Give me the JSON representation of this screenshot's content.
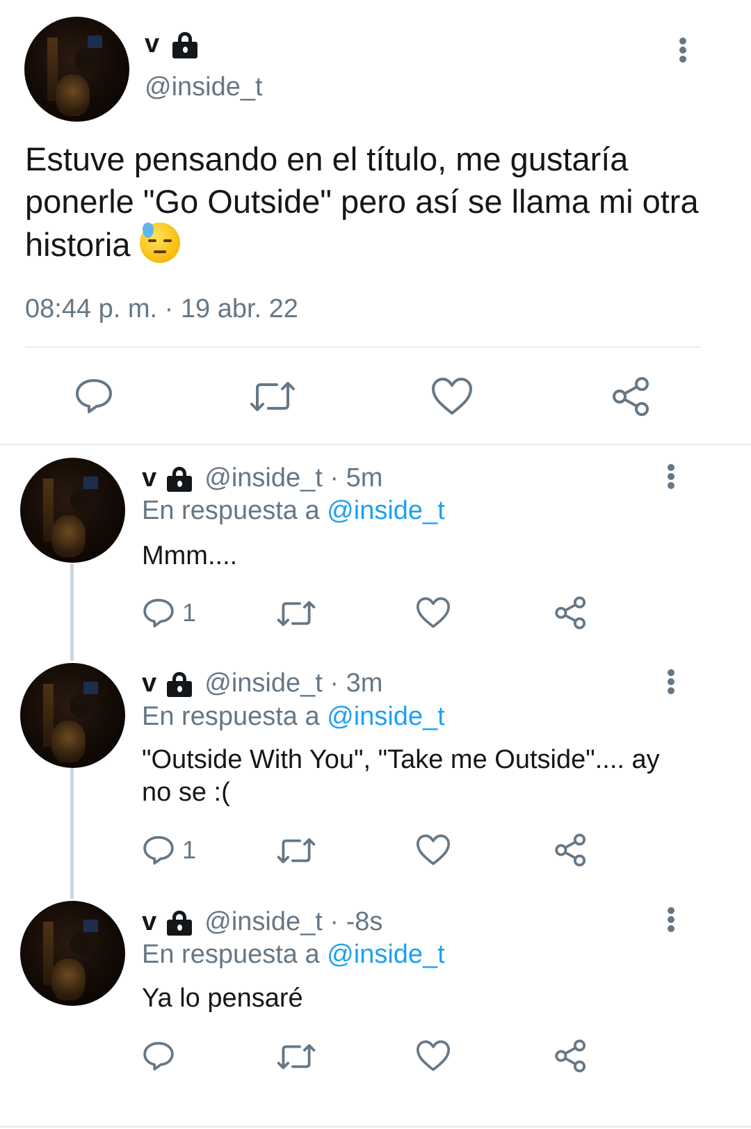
{
  "main_tweet": {
    "name": "v",
    "handle": "@inside_t",
    "text": "Estuve pensando en el título, me gustaría ponerle \"Go Outside\" pero así se llama mi otra historia",
    "emoji": "downcast-face-with-sweat",
    "timestamp": "08:44 p. m. · 19 abr. 22"
  },
  "replies": [
    {
      "name": "v",
      "handle": "@inside_t",
      "time": " · 5m",
      "reply_prefix": "En respuesta a ",
      "reply_to": "@inside_t",
      "text": "Mmm....",
      "reply_count": "1"
    },
    {
      "name": "v",
      "handle": "@inside_t",
      "time": " · 3m",
      "reply_prefix": "En respuesta a ",
      "reply_to": "@inside_t",
      "text": "\"Outside With You\", \"Take me Outside\".... ay no se :(",
      "reply_count": "1"
    },
    {
      "name": "v",
      "handle": "@inside_t",
      "time": " · -8s",
      "reply_prefix": "En respuesta a ",
      "reply_to": "@inside_t",
      "text": "Ya lo pensaré",
      "reply_count": ""
    }
  ],
  "colors": {
    "text": "#14171a",
    "secondary": "#657786",
    "link": "#1da1f2",
    "divider": "#e6ecf0"
  }
}
